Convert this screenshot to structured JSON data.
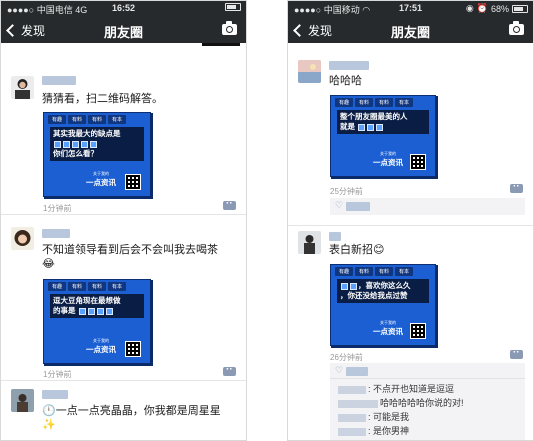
{
  "left": {
    "status": {
      "carrier": "中国电信",
      "network": "4G",
      "time": "16:52"
    },
    "nav": {
      "back_label": "发现",
      "title": "朋友圈"
    },
    "posts": [
      {
        "text": "猜猜看，扫二维码解答。",
        "card_tabs": [
          "有趣",
          "有料",
          "有料",
          "有本"
        ],
        "card_q1": "其实我最大的缺点是",
        "card_q2": "你们怎么看？",
        "card_brand": "一点资讯",
        "card_brand_small": "关于我的",
        "time": "1分钟前"
      },
      {
        "text": "不知道领导看到后会不会叫我去喝茶",
        "card_tabs": [
          "有趣",
          "有料",
          "有料",
          "有本"
        ],
        "card_q1": "逗大豆角现在最想做",
        "card_q2": "的事是",
        "card_brand": "一点资讯",
        "card_brand_small": "关于我的",
        "time": "1分钟前"
      },
      {
        "text": "一点一点亮晶晶，你我都是周星星",
        "time": ""
      }
    ]
  },
  "right": {
    "status": {
      "carrier": "中国移动",
      "network": "",
      "time": "17:51",
      "battery": "68%"
    },
    "nav": {
      "back_label": "发现",
      "title": "朋友圈"
    },
    "posts": [
      {
        "text": "哈哈哈",
        "card_tabs": [
          "有趣",
          "有料",
          "有料",
          "有本"
        ],
        "card_q1": "整个朋友圈最美的人",
        "card_q2": "就是",
        "card_brand": "一点资讯",
        "card_brand_small": "关于我的",
        "time": "25分钟前"
      },
      {
        "text": "表白新招",
        "card_tabs": [
          "有趣",
          "有料",
          "有料",
          "有本"
        ],
        "card_q1": "，喜欢你这么久",
        "card_q2": "，你还没给我点过赞",
        "card_brand": "一点资讯",
        "card_brand_small": "关于我的",
        "time": "26分钟前"
      }
    ],
    "comments": [
      {
        "text": "不点开也知道是逗逗"
      },
      {
        "text": "哈哈哈哈哈你说的对!"
      },
      {
        "text": "可能是我"
      },
      {
        "text": "是你男神"
      }
    ]
  },
  "colors": {
    "nav_bg": "#262a2d",
    "card_blue": "#1b5fd3",
    "nick_blue": "#b9c7dd"
  }
}
